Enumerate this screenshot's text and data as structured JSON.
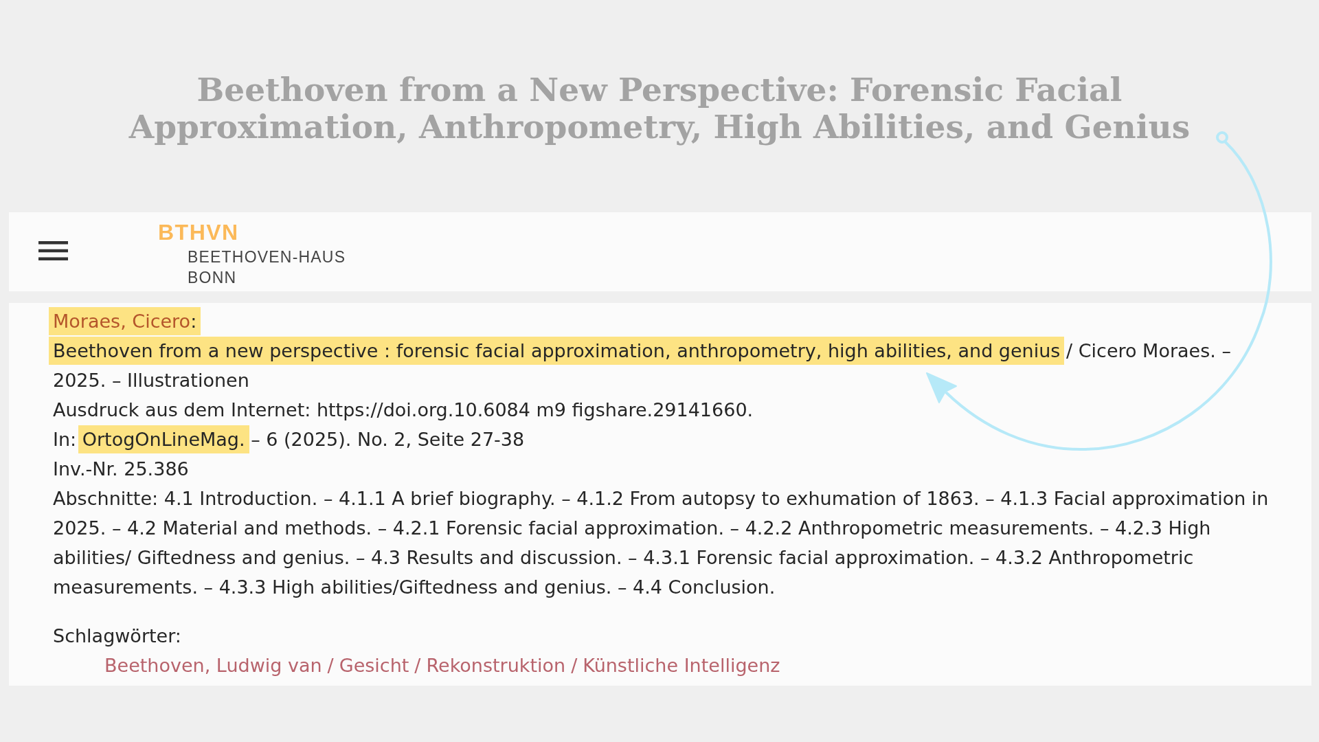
{
  "page_title": "Beethoven from a New Perspective: Forensic Facial Approximation, Anthropometry, High Abilities, and Genius",
  "header": {
    "logo_mark": "BTHVN",
    "logo_lines": [
      "BEETHOVEN-HAUS",
      "BONN"
    ]
  },
  "record": {
    "author": {
      "name": "Moraes, Cicero",
      "separator": ":",
      "highlighted": true
    },
    "title_statement": [
      {
        "text": "Beethoven from a new perspective : forensic facial approximation, anthropometry, high abilities, and genius",
        "highlighted": true
      },
      {
        "text": " / Cicero Moraes. – 2025. – Illustrationen",
        "highlighted": false
      }
    ],
    "note": "Ausdruck aus dem Internet: https://doi.org.10.6084 m9 figshare.29141660.",
    "source": [
      {
        "text": "In: ",
        "highlighted": false
      },
      {
        "text": "OrtogOnLineMag.",
        "highlighted": true
      },
      {
        "text": " – 6 (2025). No. 2, Seite 27-38",
        "highlighted": false
      }
    ],
    "inventory": "Inv.-Nr. 25.386",
    "contents": "Abschnitte: 4.1 Introduction. – 4.1.1 A brief biography. – 4.1.2 From autopsy to exhumation of 1863. – 4.1.3 Facial approximation in 2025. – 4.2 Material and methods. – 4.2.1 Forensic facial approximation. – 4.2.2 Anthropometric measurements. – 4.2.3 High abilities/ Giftedness and genius. – 4.3 Results and discussion. – 4.3.1 Forensic facial approximation. – 4.3.2 Anthropometric measurements. – 4.3.3 High abilities/Giftedness and genius. – 4.4 Conclusion.",
    "subjects_label": "Schlagwörter:",
    "subject_separator": "/",
    "subjects": [
      "Beethoven, Ludwig van",
      "Gesicht",
      "Rekonstruktion",
      "Künstliche Intelligenz"
    ]
  }
}
